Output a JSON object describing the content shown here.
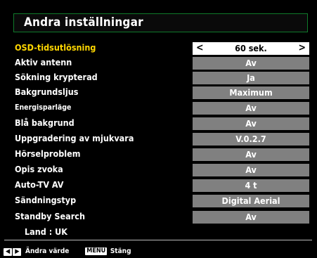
{
  "title": "Andra inställningar",
  "rows": [
    {
      "label": "OSD-tidsutlösning",
      "value": "60 sek."
    },
    {
      "label": "Aktiv antenn",
      "value": "Av"
    },
    {
      "label": "Sökning krypterad",
      "value": "Ja"
    },
    {
      "label": "Bakgrundsljus",
      "value": "Maximum"
    },
    {
      "label": "Energisparläge",
      "value": "Av"
    },
    {
      "label": "Blå bakgrund",
      "value": "Av"
    },
    {
      "label": "Uppgradering av mjukvara",
      "value": "V.0.2.7"
    },
    {
      "label": "Hörselproblem",
      "value": "Av"
    },
    {
      "label": "Opis zvoka",
      "value": "Av"
    },
    {
      "label": "Auto-TV AV",
      "value": "4 t"
    },
    {
      "label": "Sändningstyp",
      "value": "Digital Aerial"
    },
    {
      "label": "Standby Search",
      "value": "Av"
    }
  ],
  "selected_arrows": {
    "left": "<",
    "right": ">"
  },
  "land_label": "Land : UK",
  "footer": {
    "arrow_keys": {
      "left": "◀",
      "right": "▶"
    },
    "change_label": "Ändra värde",
    "menu_key": "MENU",
    "close_label": "Stäng"
  },
  "colors": {
    "title_border": "#0f7a2a",
    "highlight_label": "#ffd700",
    "value_box": "#808080",
    "selected_box": "#ffffff"
  }
}
